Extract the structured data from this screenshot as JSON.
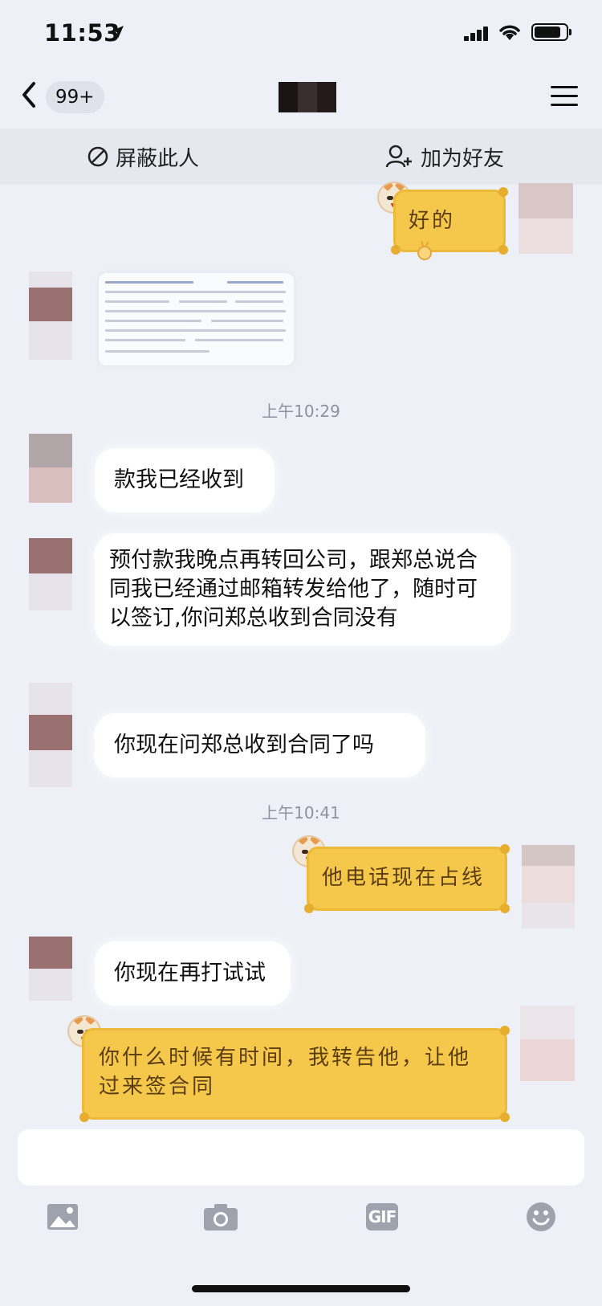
{
  "status_bar": {
    "time": "11:53",
    "signal_icon": "cellular-signal-icon",
    "wifi_icon": "wifi-icon",
    "battery_icon": "battery-icon",
    "battery_level": 0.85
  },
  "nav": {
    "back_icon": "chevron-left-icon",
    "unread_badge": "99+",
    "title_redacted": true,
    "menu_icon": "hamburger-menu-icon"
  },
  "actions": {
    "block_label": "屏蔽此人",
    "block_icon": "block-icon",
    "add_friend_label": "加为好友",
    "add_friend_icon": "add-friend-icon"
  },
  "messages": [
    {
      "side": "right",
      "style": "yellow-sticker",
      "text": "好的",
      "emoji": "ok-hand-emoji"
    },
    {
      "side": "left",
      "type": "image",
      "description": "document-screenshot"
    },
    {
      "type": "timestamp",
      "text": "上午10:29"
    },
    {
      "side": "left",
      "text": "款我已经收到"
    },
    {
      "side": "left",
      "text": "预付款我晚点再转回公司，跟郑总说合同我已经通过邮箱转发给他了，随时可以签订,你问郑总收到合同没有"
    },
    {
      "side": "left",
      "text": "你现在问郑总收到合同了吗"
    },
    {
      "type": "timestamp",
      "text": "上午10:41"
    },
    {
      "side": "right",
      "style": "yellow-sticker",
      "text": "他电话现在占线"
    },
    {
      "side": "left",
      "text": "你现在再打试试"
    },
    {
      "side": "right",
      "style": "yellow-sticker",
      "text": "你什么时候有时间，我转告他，让他过来签合同"
    }
  ],
  "input": {
    "placeholder": ""
  },
  "toolbar": {
    "photo_icon": "image-icon",
    "camera_icon": "camera-icon",
    "gif_label": "GIF",
    "emoji_icon": "emoji-smile-icon"
  },
  "colors": {
    "background": "#eef0f7",
    "bubble_white": "#ffffff",
    "bubble_yellow": "#f5c74a",
    "timestamp": "#8d92a0"
  }
}
